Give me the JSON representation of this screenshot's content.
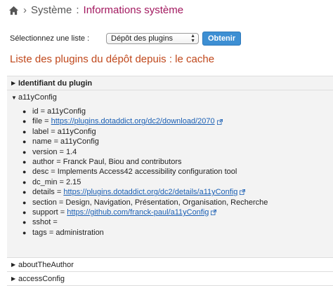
{
  "breadcrumb": {
    "home_icon": "home-icon",
    "parent": "Système",
    "separator": ":",
    "current": "Informations système",
    "current_color": "#a2185f"
  },
  "form": {
    "label": "Sélectionnez une liste :",
    "selected": "Dépôt des plugins",
    "button": "Obtenir",
    "button_color": "#3d8fd3"
  },
  "section_title": "Liste des plugins du dépôt depuis : le cache",
  "section_title_color": "#c0481c",
  "tree": {
    "header": "Identifiant du plugin",
    "expanded": {
      "name": "a11yConfig",
      "properties": [
        {
          "text": "id = a11yConfig"
        },
        {
          "text": "file = ",
          "link": "https://plugins.dotaddict.org/dc2/download/2070"
        },
        {
          "text": "label = a11yConfig"
        },
        {
          "text": "name = a11yConfig"
        },
        {
          "text": "version = 1.4"
        },
        {
          "text": "author = Franck Paul, Biou and contributors"
        },
        {
          "text": "desc = Implements Access42 accessibility configuration tool"
        },
        {
          "text": "dc_min = 2.15"
        },
        {
          "text": "details = ",
          "link": "https://plugins.dotaddict.org/dc2/details/a11yConfig"
        },
        {
          "text": "section = Design, Navigation, Présentation, Organisation, Recherche"
        },
        {
          "text": "support = ",
          "link": "https://github.com/franck-paul/a11yConfig"
        },
        {
          "text": "sshot ="
        },
        {
          "text": "tags = administration"
        }
      ]
    },
    "collapsed": [
      "aboutTheAuthor",
      "accessConfig"
    ]
  }
}
